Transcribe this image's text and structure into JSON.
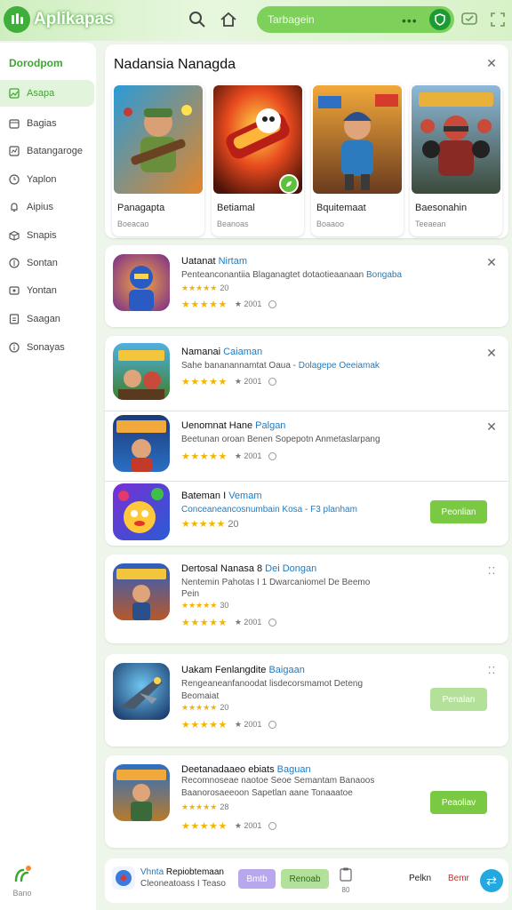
{
  "colors": {
    "accent": "#3aa82b",
    "button": "#7ac943",
    "button_light": "#b4e19a",
    "link": "#1f7bc2",
    "star": "#f2b600"
  },
  "header": {
    "app_name": "Aplikapas",
    "search_placeholder": "Tarbagein",
    "icons": [
      "search-icon",
      "home-icon",
      "shield-icon",
      "chat-icon",
      "expand-icon"
    ]
  },
  "sidebar": {
    "title": "Dorodpom",
    "items": [
      {
        "label": "Asapa",
        "icon": "image-icon"
      },
      {
        "label": "Bagias",
        "icon": "calendar-icon"
      },
      {
        "label": "Batangaroge",
        "icon": "chart-icon"
      },
      {
        "label": "Yaplon",
        "icon": "clock-icon"
      },
      {
        "label": "Aipius",
        "icon": "bell-icon"
      },
      {
        "label": "Snapis",
        "icon": "box-icon"
      },
      {
        "label": "Sontan",
        "icon": "coin-icon"
      },
      {
        "label": "Yontan",
        "icon": "photo-icon"
      },
      {
        "label": "Saagan",
        "icon": "file-icon"
      },
      {
        "label": "Sonayas",
        "icon": "info-icon"
      }
    ],
    "bottom_label": "Bano"
  },
  "featured": {
    "title": "Nadansia Nanagda",
    "cards": [
      {
        "name": "Panagapta",
        "sub": "Boeacao"
      },
      {
        "name": "Betiamal",
        "sub": "Beanoas"
      },
      {
        "name": "Bquitemaat",
        "sub": "Boaaoo"
      },
      {
        "name": "Baesonahin",
        "sub": "Teeaean"
      }
    ]
  },
  "rows": [
    {
      "title": "Uatanat ",
      "title_hl": "Nirtam",
      "desc": "Penteanconantiia Blaganagtet dotaotieaanaan ",
      "desc_hl": "Bongaba",
      "mini": "★★★★★",
      "mini_n": "20",
      "stars": "★★★★★",
      "count": "2001"
    },
    {
      "title": "Namanai ",
      "title_hl": "Caiaman",
      "desc": "Sahe bananannamtat Oaua - ",
      "desc_hl": "Dolagepe Oeeiamak",
      "stars": "★★★★★",
      "count": "2001"
    },
    {
      "title": "Uenomnat Hane ",
      "title_hl": "Palgan",
      "desc": "Beetunan oroan Benen Sopepotn Anmetaslarpang",
      "desc_hl": "",
      "stars": "★★★★★",
      "count": "2001"
    },
    {
      "title": "Bateman I ",
      "title_hl": "Vemam",
      "desc": "",
      "desc_hl": "Conceaneancosnumbain Kosa - F3 planham",
      "mini": "★★★★★",
      "mini_n": "20",
      "button": "Peonlian"
    },
    {
      "title": "Dertosal Nanasa 8 ",
      "title_hl": "Dei Dongan",
      "desc": "Nentemin Pahotas I 1 Dwarcaniomel De Beemo",
      "desc2": "Pein",
      "mini": "★★★★★",
      "mini_n": "30",
      "stars": "★★★★★",
      "count": "2001"
    },
    {
      "title": "Uakam Fenlangdite ",
      "title_hl": "Baigaan",
      "desc": "Rengeaneanfanoodat lisdecorsmamot Deteng",
      "desc2": "Beomaiat",
      "mini": "★★★★★",
      "mini_n": "20",
      "stars": "★★★★★",
      "count": "2001",
      "button": "Penalan"
    },
    {
      "title": "Deetanadaaeo ebiats ",
      "title_hl": "Baguan",
      "desc": "Recomnoseae naotoe Seoe Semantam Banaoos",
      "desc2": "Baanorosaeeoon Sapetlan aane Tonaaatoe",
      "mini": "★★★★★",
      "mini_n": "28",
      "stars": "★★★★★",
      "count": "2001",
      "button": "Peaoliav"
    }
  ],
  "bottombar": {
    "title": "Vhnta ",
    "title_hl": "Repiobtemaan",
    "sub": "Cleoneatoass  I  Teaso",
    "btn1": "Bmtb",
    "btn2": "Renoab",
    "num": "80",
    "t1": "Pelkn",
    "t2": "Bemr"
  }
}
